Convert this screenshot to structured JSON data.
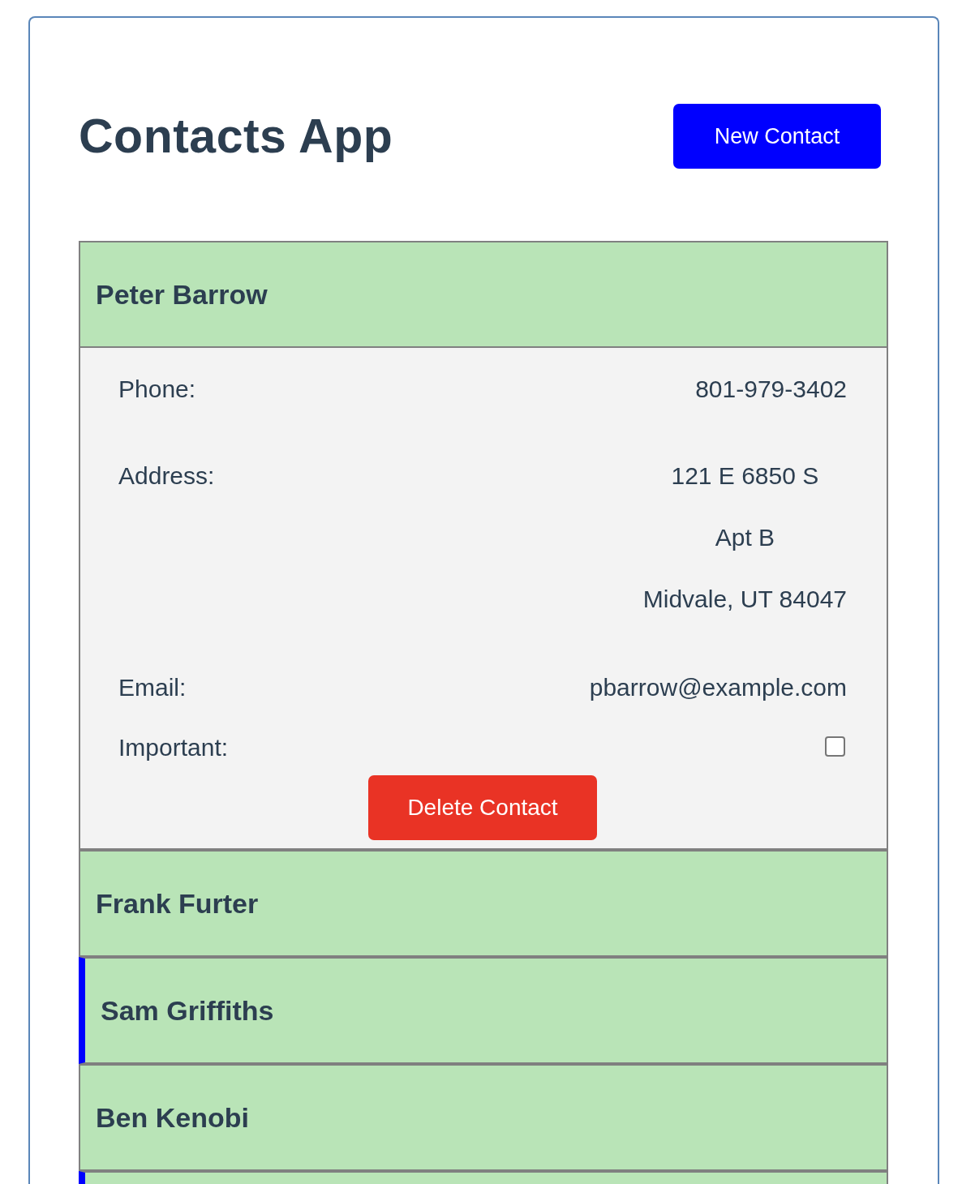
{
  "header": {
    "title": "Contacts App",
    "new_button": "New Contact"
  },
  "contacts": [
    {
      "name": "Peter Barrow",
      "important": false,
      "details": {
        "phone_label": "Phone:",
        "phone": "801-979-3402",
        "address_label": "Address:",
        "address_lines": [
          "121 E 6850 S",
          "Apt B",
          "Midvale, UT 84047"
        ],
        "email_label": "Email:",
        "email": "pbarrow@example.com",
        "important_label": "Important:",
        "delete_button": "Delete Contact"
      }
    },
    {
      "name": "Frank Furter",
      "important": false
    },
    {
      "name": "Sam Griffiths",
      "important": true
    },
    {
      "name": "Ben Kenobi",
      "important": false
    },
    {
      "important": true
    }
  ]
}
